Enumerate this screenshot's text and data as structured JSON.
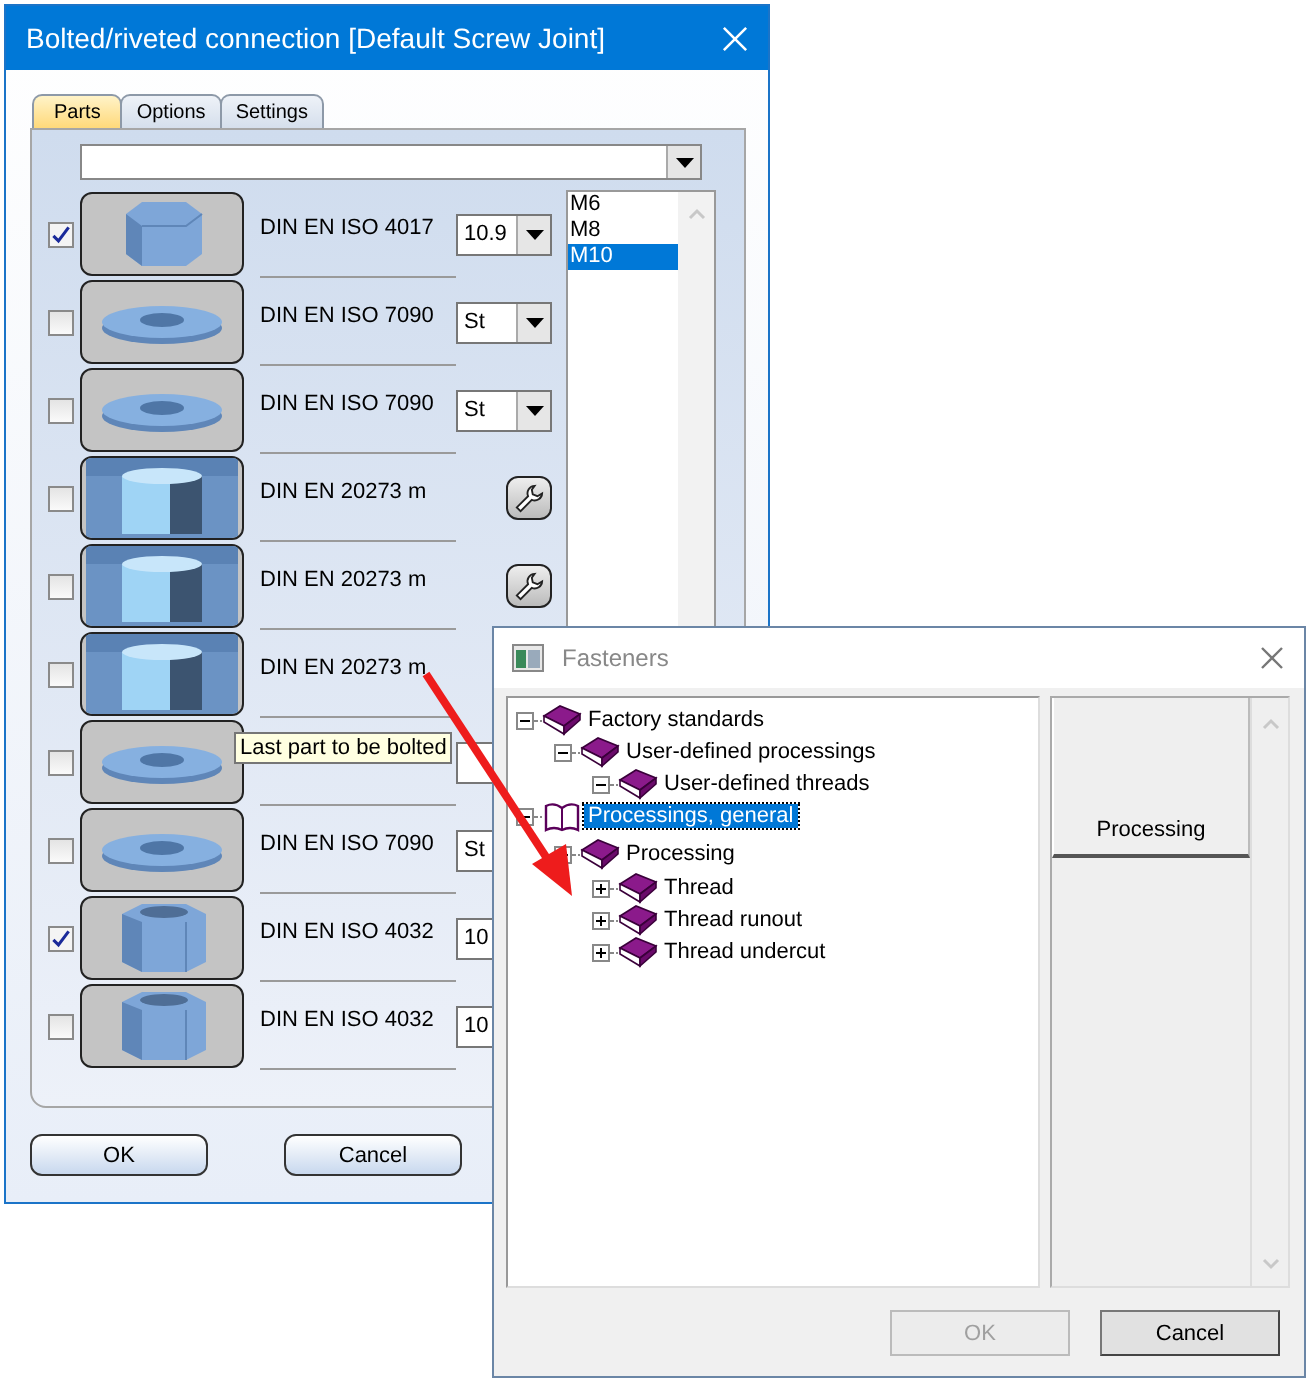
{
  "main_window": {
    "title": "Bolted/riveted connection [Default Screw Joint]",
    "tabs": [
      {
        "label": "Parts",
        "selected": true
      },
      {
        "label": "Options",
        "selected": false
      },
      {
        "label": "Settings",
        "selected": false
      }
    ],
    "parts": [
      {
        "checked": true,
        "kind": "bolt",
        "label": "DIN EN ISO 4017",
        "dropdown": true,
        "value": "10.9"
      },
      {
        "checked": false,
        "kind": "washer",
        "label": "DIN EN ISO 7090",
        "dropdown": true,
        "value": "St"
      },
      {
        "checked": false,
        "kind": "washer",
        "label": "DIN EN ISO 7090",
        "dropdown": true,
        "value": "St"
      },
      {
        "checked": false,
        "kind": "hole",
        "label": "DIN EN 20273 m",
        "dropdown": false,
        "wrench": true
      },
      {
        "checked": false,
        "kind": "hole",
        "label": "DIN EN 20273 m",
        "dropdown": false,
        "wrench": true
      },
      {
        "checked": false,
        "kind": "hole",
        "label": "DIN EN 20273 m",
        "dropdown": false
      },
      {
        "checked": false,
        "kind": "washer",
        "dropdown": true
      },
      {
        "checked": false,
        "kind": "washer",
        "label": "DIN EN ISO 7090",
        "dropdown": true,
        "value": "St"
      },
      {
        "checked": true,
        "kind": "nut",
        "label": "DIN EN ISO 4032",
        "dropdown": true,
        "value": "10"
      },
      {
        "checked": false,
        "kind": "nut",
        "label": "DIN EN ISO 4032",
        "dropdown": true,
        "value": "10"
      }
    ],
    "sizes": [
      {
        "label": "M6",
        "selected": false
      },
      {
        "label": "M8",
        "selected": false
      },
      {
        "label": "M10",
        "selected": true
      }
    ],
    "tooltip": "Last part to be bolted",
    "buttons": [
      "OK",
      "Cancel"
    ]
  },
  "fasteners_window": {
    "title": "Fasteners",
    "tree": [
      {
        "label": "Factory standards",
        "kind": "book",
        "expanded": true,
        "selected": false,
        "children": [
          {
            "label": "User-defined processings",
            "kind": "book",
            "expanded": true,
            "selected": false,
            "children": [
              {
                "label": "User-defined threads",
                "kind": "book",
                "expanded": true,
                "selected": false
              }
            ]
          }
        ]
      },
      {
        "label": "Processings, general",
        "kind": "open-book",
        "expanded": true,
        "selected": true,
        "children": [
          {
            "label": "Processing",
            "kind": "book",
            "expanded": true,
            "selected": false,
            "children": [
              {
                "label": "Thread",
                "kind": "book",
                "expanded": false,
                "selected": false
              },
              {
                "label": "Thread runout",
                "kind": "book",
                "expanded": false,
                "selected": false
              },
              {
                "label": "Thread undercut",
                "kind": "book",
                "expanded": false,
                "selected": false
              }
            ]
          }
        ]
      }
    ],
    "column_header": "Processing",
    "buttons": [
      {
        "label": "OK",
        "disabled": true
      },
      {
        "label": "Cancel",
        "disabled": false
      }
    ]
  }
}
